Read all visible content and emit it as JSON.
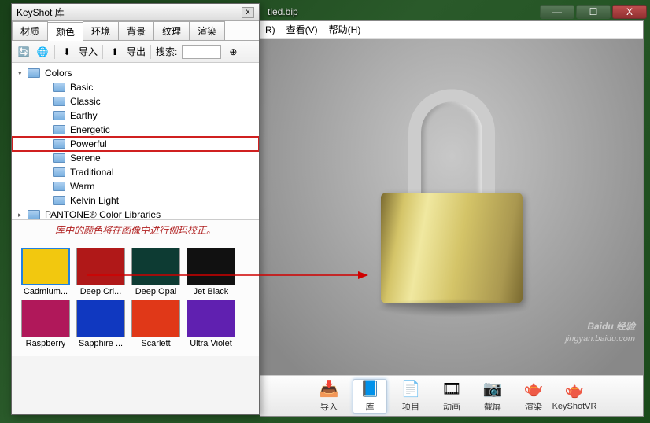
{
  "main_window": {
    "title_fragment": "tled.bip",
    "menu": {
      "item_r": "R)",
      "view": "查看(V)",
      "help": "帮助(H)"
    },
    "win_ctrl": {
      "min": "—",
      "max": "☐",
      "close": "X"
    }
  },
  "bottom_toolbar": [
    {
      "icon": "📥",
      "label": "导入"
    },
    {
      "icon": "📘",
      "label": "库",
      "active": true
    },
    {
      "icon": "📄",
      "label": "项目"
    },
    {
      "icon": "🎞",
      "label": "动画"
    },
    {
      "icon": "📷",
      "label": "截屏"
    },
    {
      "icon": "🫖",
      "label": "渲染"
    },
    {
      "icon": "🫖",
      "label": "KeyShotVR"
    }
  ],
  "watermark": {
    "brand": "Baidu 经验",
    "url": "jingyan.baidu.com"
  },
  "library": {
    "title": "KeyShot 库",
    "tabs": [
      "材质",
      "颜色",
      "环境",
      "背景",
      "纹理",
      "渲染"
    ],
    "active_tab": "颜色",
    "toolbar": {
      "import": "导入",
      "export": "导出",
      "search_label": "搜索:",
      "search_value": ""
    },
    "tree": {
      "root1": "Colors",
      "children": [
        "Basic",
        "Classic",
        "Earthy",
        "Energetic",
        "Powerful",
        "Serene",
        "Traditional",
        "Warm",
        "Kelvin Light"
      ],
      "highlighted": "Powerful",
      "root2": "PANTONE® Color Libraries"
    },
    "note": "库中的颜色将在图像中进行伽玛校正。",
    "swatches": [
      {
        "label": "Cadmium...",
        "color": "#f2c80f",
        "selected": true
      },
      {
        "label": "Deep Cri...",
        "color": "#b01818"
      },
      {
        "label": "Deep Opal",
        "color": "#0d3b33"
      },
      {
        "label": "Jet Black",
        "color": "#111111"
      },
      {
        "label": "Raspberry",
        "color": "#b0185a"
      },
      {
        "label": "Sapphire ...",
        "color": "#1038c0"
      },
      {
        "label": "Scarlett",
        "color": "#e03818"
      },
      {
        "label": "Ultra Violet",
        "color": "#6020b0"
      }
    ]
  }
}
